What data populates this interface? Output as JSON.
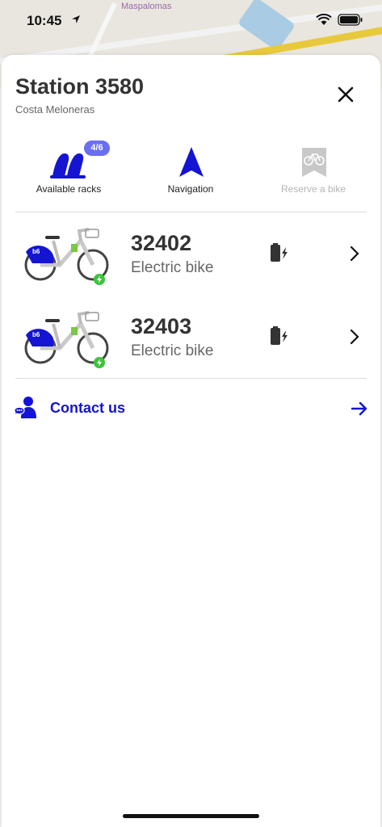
{
  "status_bar": {
    "time": "10:45"
  },
  "map": {
    "place_label": "Maspalomas"
  },
  "station": {
    "title": "Station 3580",
    "subtitle": "Costa Meloneras"
  },
  "actions": {
    "racks": {
      "label": "Available racks",
      "badge": "4/6"
    },
    "navigation": {
      "label": "Navigation"
    },
    "reserve": {
      "label": "Reserve a bike"
    }
  },
  "bikes": [
    {
      "number": "32402",
      "type": "Electric bike"
    },
    {
      "number": "32403",
      "type": "Electric bike"
    }
  ],
  "contact": {
    "label": "Contact us"
  },
  "colors": {
    "accent": "#1414d2",
    "badge": "#6a6ef2",
    "charge": "#3cc33c"
  }
}
